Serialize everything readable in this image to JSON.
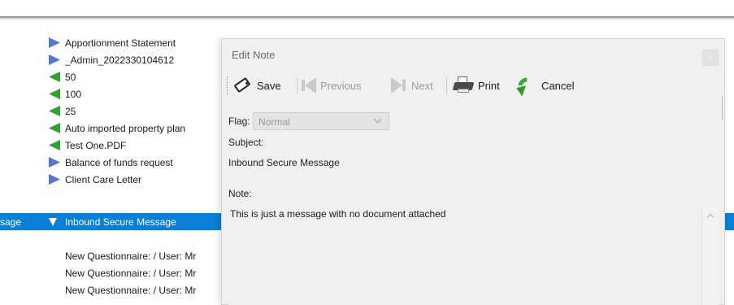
{
  "list": {
    "items": [
      {
        "label": "Apportionment Statement",
        "icon": "arrow-right-icon",
        "color": "#5577cc"
      },
      {
        "label": "_Admin_2022330104612",
        "icon": "arrow-right-icon",
        "color": "#5577cc"
      },
      {
        "label": "50",
        "icon": "arrow-left-icon",
        "color": "#2ea12e"
      },
      {
        "label": "100",
        "icon": "arrow-left-icon",
        "color": "#2ea12e"
      },
      {
        "label": "25",
        "icon": "arrow-left-icon",
        "color": "#2ea12e"
      },
      {
        "label": "Auto imported property plan",
        "icon": "arrow-left-icon",
        "color": "#2ea12e"
      },
      {
        "label": "Test One.PDF",
        "icon": "arrow-left-icon",
        "color": "#2ea12e"
      },
      {
        "label": "Balance of funds request",
        "icon": "arrow-right-icon",
        "color": "#5577cc"
      },
      {
        "label": "Client Care Letter",
        "icon": "arrow-right-icon",
        "color": "#5577cc"
      }
    ],
    "selected": {
      "prefix": "sage",
      "label": "Inbound Secure Message",
      "icon": "arrow-down-icon",
      "highlight": "#0b7fd6"
    },
    "questionnaires": [
      "New Questionnaire:  / User: Mr",
      "New Questionnaire:  / User: Mr",
      "New Questionnaire:  / User: Mr"
    ]
  },
  "dialog": {
    "title": "Edit Note",
    "close_label": "×",
    "toolbar": {
      "save": "Save",
      "previous": "Previous",
      "next": "Next",
      "print": "Print",
      "cancel": "Cancel"
    },
    "flag_label": "Flag:",
    "flag_value": "Normal",
    "subject_label": "Subject:",
    "subject_value": "Inbound Secure Message",
    "note_label": "Note:",
    "note_value": "This is just a message with no document attached"
  }
}
